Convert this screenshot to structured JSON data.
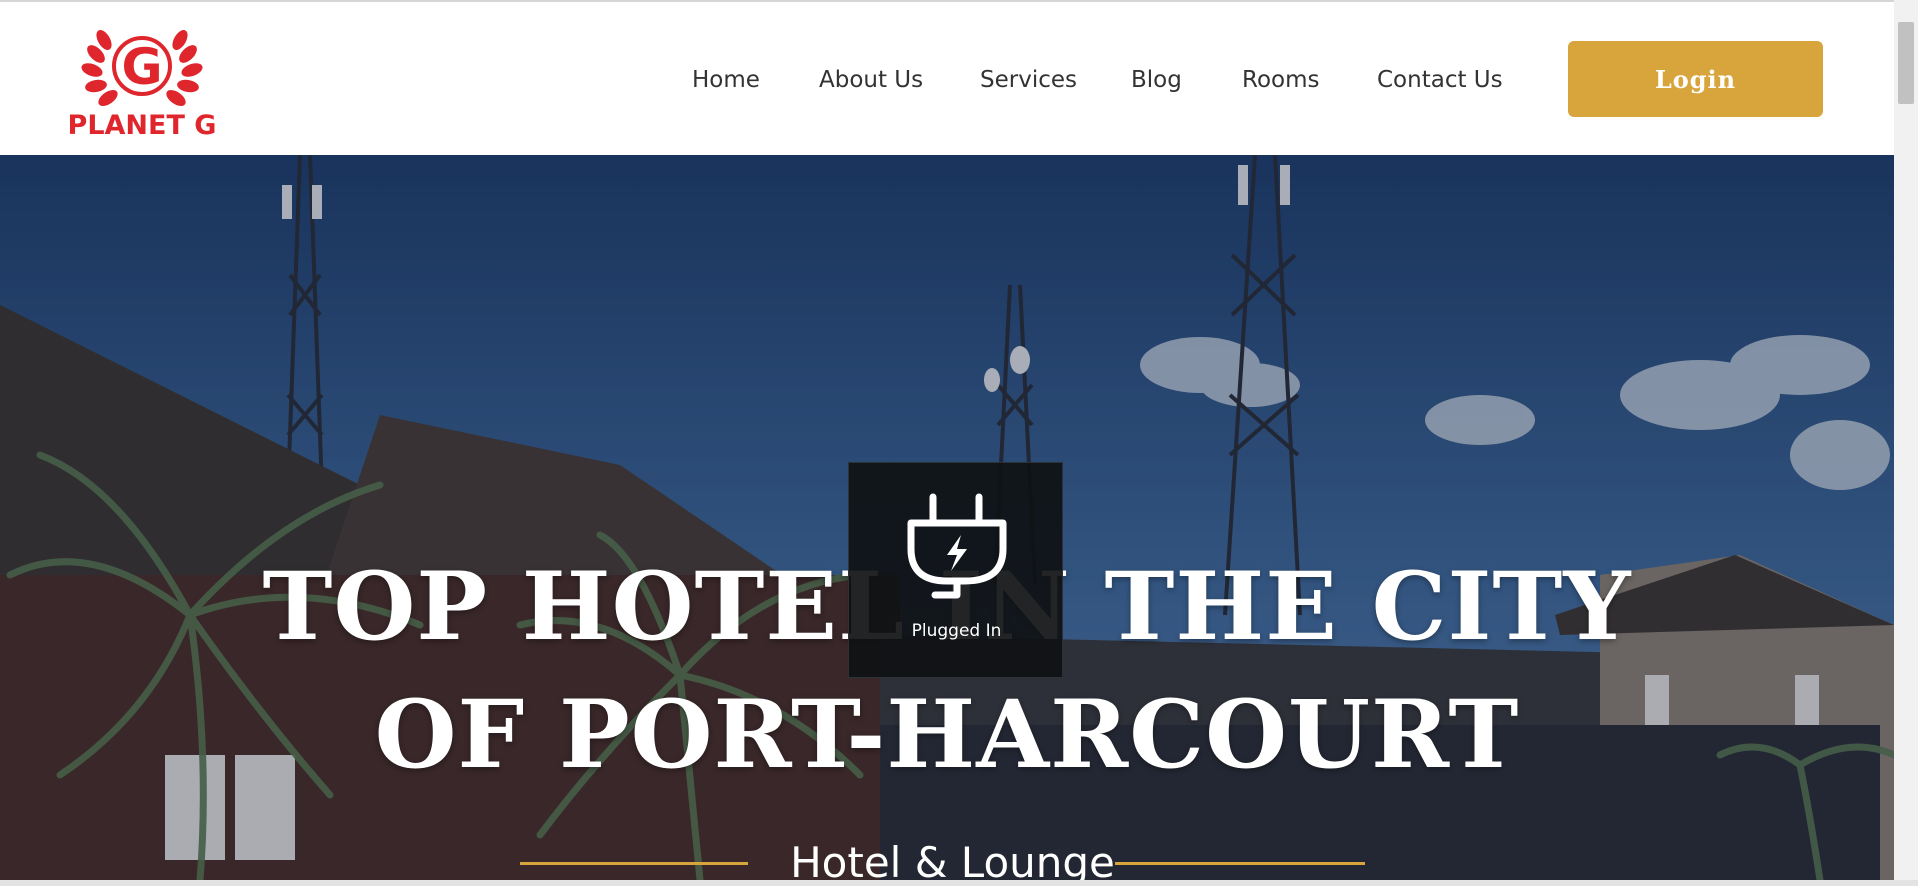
{
  "brand": {
    "logo_letter": "G",
    "logo_text": "PLANET G",
    "logo_color": "#e0262d"
  },
  "nav": {
    "items": [
      {
        "label": "Home"
      },
      {
        "label": "About Us"
      },
      {
        "label": "Services"
      },
      {
        "label": "Blog"
      },
      {
        "label": "Rooms"
      },
      {
        "label": "Contact Us"
      }
    ],
    "login_label": "Login",
    "accent_color": "#d8a53c"
  },
  "hero": {
    "title_line1": "TOP HOTEL IN THE CITY",
    "title_line2": "OF PORT-HARCOURT",
    "subtitle": "Hotel & Lounge"
  },
  "overlay": {
    "label": "Plugged In",
    "icon": "power-plug-icon"
  }
}
